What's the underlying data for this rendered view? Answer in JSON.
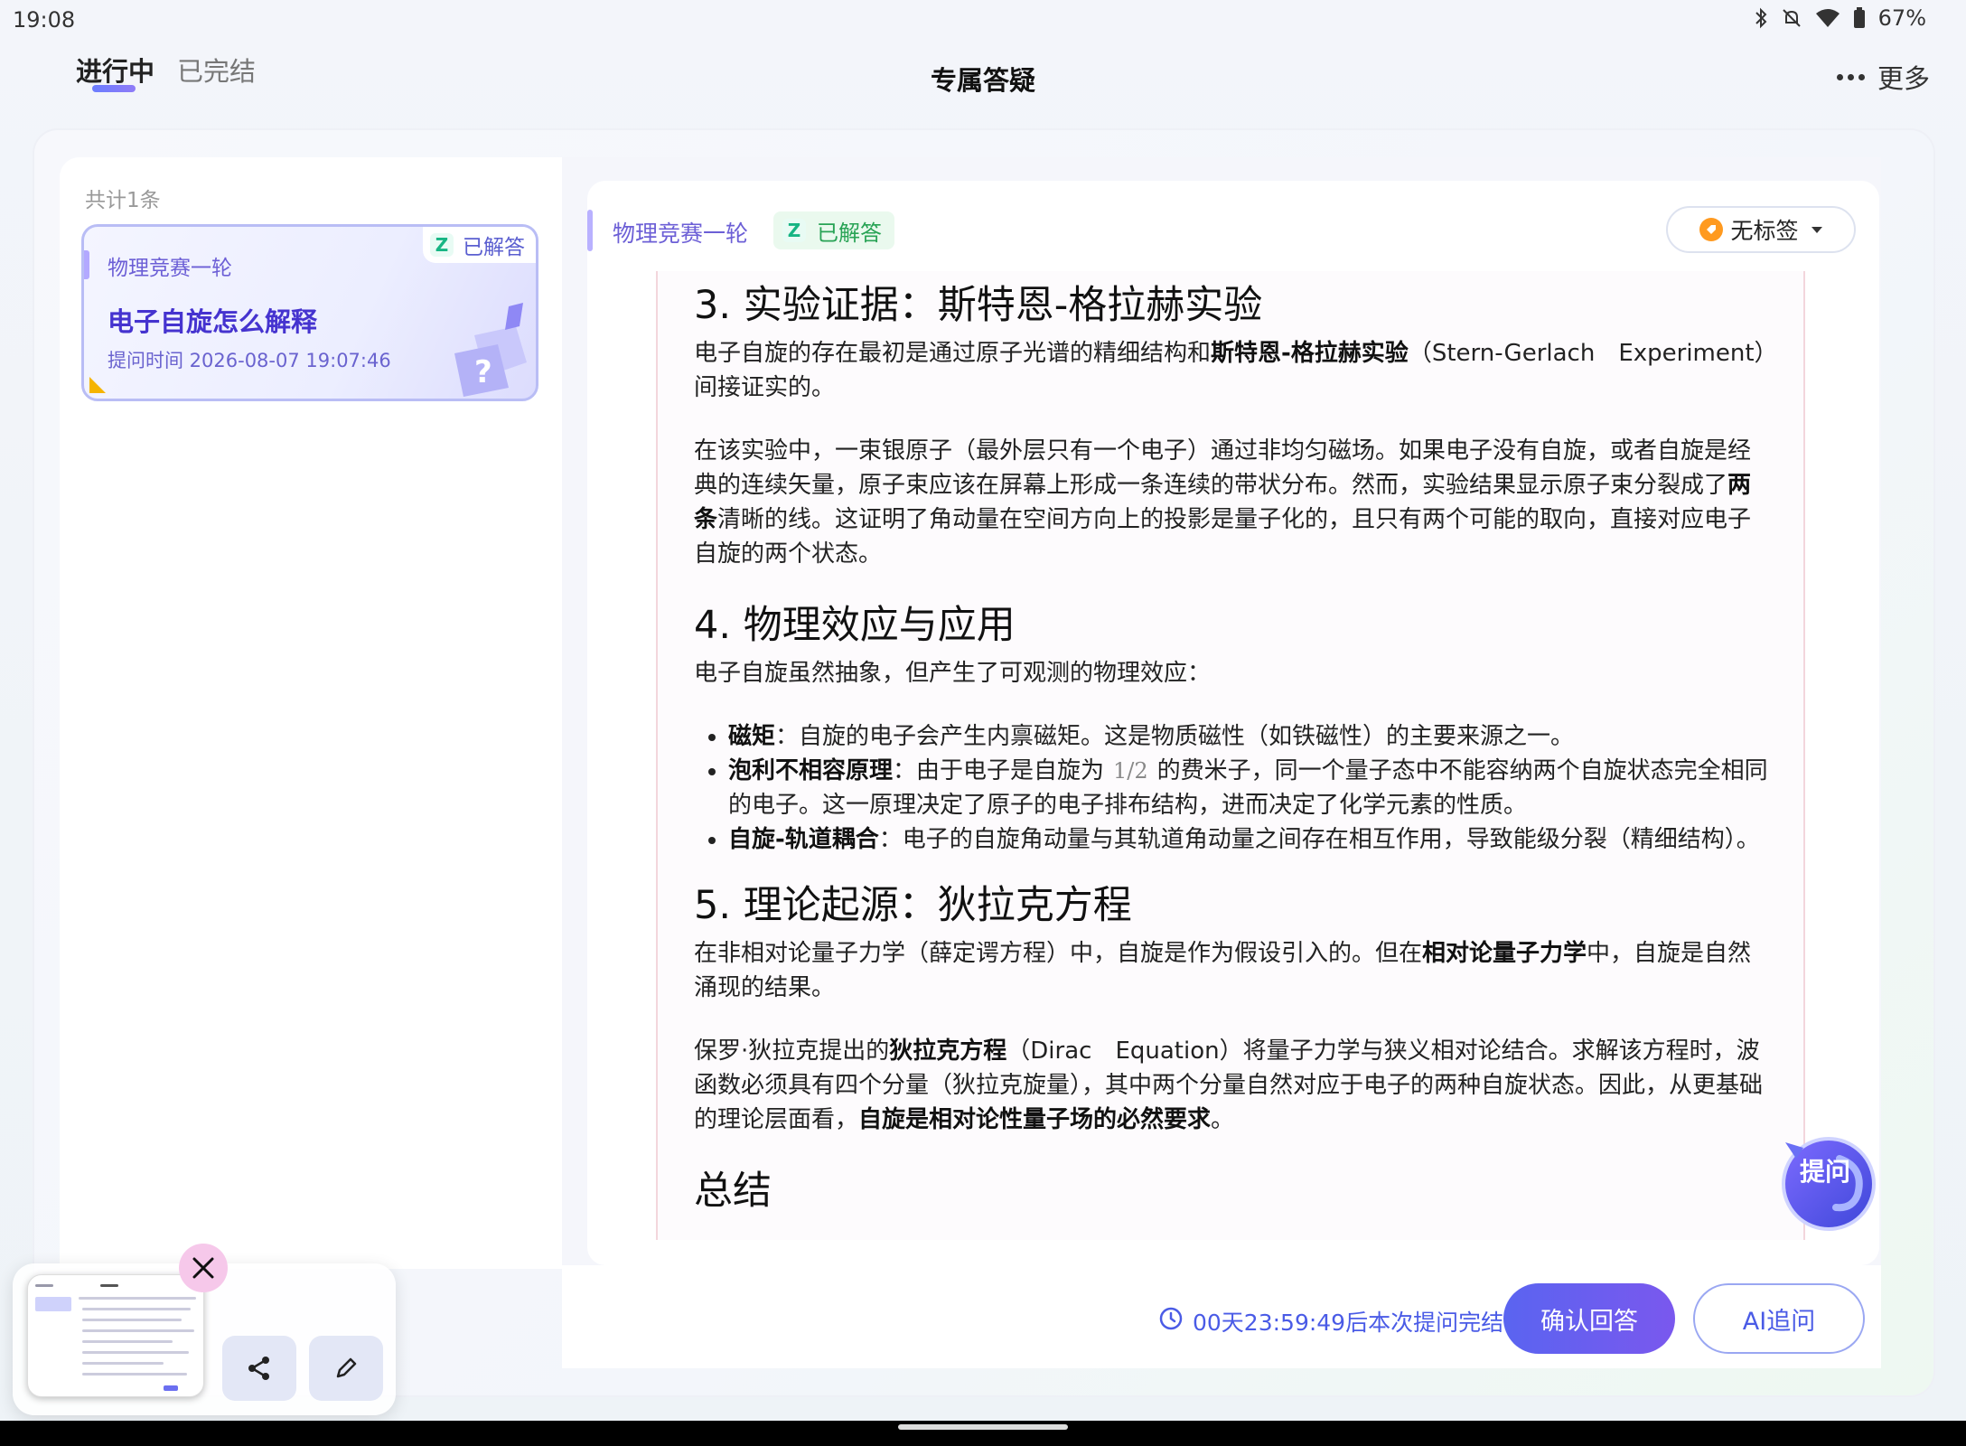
{
  "status_bar": {
    "time": "19:08",
    "battery": "67%"
  },
  "header": {
    "tabs": [
      {
        "label": "进行中",
        "active": true
      },
      {
        "label": "已完结",
        "active": false
      }
    ],
    "title": "专属答疑",
    "more_label": "更多"
  },
  "sidebar": {
    "count_label": "共计1条",
    "card": {
      "category": "物理竞赛一轮",
      "badge_logo": "Z",
      "badge": "已解答",
      "title": "电子自旋怎么解释",
      "time": "提问时间 2026-08-07 19:07:46"
    }
  },
  "content": {
    "category": "物理竞赛一轮",
    "badge_logo": "Z",
    "badge": "已解答",
    "tag_label": "无标签",
    "sections": {
      "s3": {
        "heading": "3. 实验证据：斯特恩-格拉赫实验",
        "p1_a": "电子自旋的存在最初是通过原子光谱的精细结构和",
        "p1_b": "斯特恩-格拉赫实验",
        "p1_c": "（Stern-Gerlach　Experiment）间接证实的。",
        "p2_a": "在该实验中，一束银原子（最外层只有一个电子）通过非均匀磁场。如果电子没有自旋，或者自旋是经典的连续矢量，原子束应该在屏幕上形成一条连续的带状分布。然而，实验结果显示原子束分裂成了",
        "p2_b": "两条",
        "p2_c": "清晰的线。这证明了角动量在空间方向上的投影是量子化的，且只有两个可能的取向，直接对应电子自旋的两个状态。"
      },
      "s4": {
        "heading": "4. 物理效应与应用",
        "intro": "电子自旋虽然抽象，但产生了可观测的物理效应：",
        "items": [
          {
            "term": "磁矩",
            "text": "：自旋的电子会产生内禀磁矩。这是物质磁性（如铁磁性）的主要来源之一。"
          },
          {
            "term": "泡利不相容原理",
            "text_a": "：由于电子是自旋为",
            "math": "1/2",
            "text_b": "的费米子，同一个量子态中不能容纳两个自旋状态完全相同的电子。这一原理决定了原子的电子排布结构，进而决定了化学元素的性质。"
          },
          {
            "term": "自旋-轨道耦合",
            "text": "：电子的自旋角动量与其轨道角动量之间存在相互作用，导致能级分裂（精细结构）。"
          }
        ]
      },
      "s5": {
        "heading": "5. 理论起源：狄拉克方程",
        "p1_a": "在非相对论量子力学（薛定谔方程）中，自旋是作为假设引入的。但在",
        "p1_b": "相对论量子力学",
        "p1_c": "中，自旋是自然涌现的结果。",
        "p2_a": "保罗·狄拉克提出的",
        "p2_b": "狄拉克方程",
        "p2_c": "（Dirac　Equation）将量子力学与狭义相对论结合。求解该方程时，波函数必须具有四个分量（狄拉克旋量），其中两个分量自然对应于电子的两种自旋状态。因此，从更基础的理论层面看，",
        "p2_d": "自旋是相对论性量子场的必然要求",
        "p2_e": "。"
      },
      "summary_heading": "总结"
    },
    "fab_label": "提问"
  },
  "footer": {
    "countdown": "00天23:59:49后本次提问完结",
    "confirm_label": "确认回答",
    "ai_label": "AI追问"
  },
  "colors": {
    "accent": "#4a5be6",
    "accent_purple": "#6c5fd6",
    "success": "#28a355"
  },
  "icons": [
    "bluetooth-icon",
    "mute-icon",
    "wifi-icon",
    "battery-icon",
    "more-dots-icon",
    "clock-icon",
    "share-icon",
    "edit-icon",
    "close-icon"
  ]
}
